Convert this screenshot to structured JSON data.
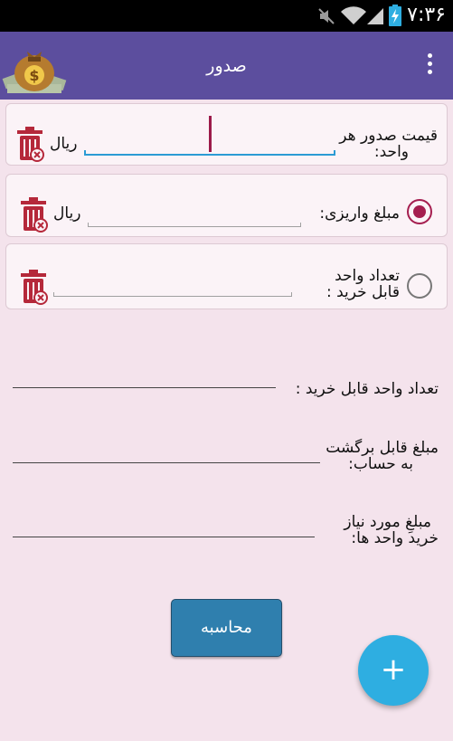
{
  "status_bar": {
    "time": "۷:۳۶",
    "icons": [
      "mute-icon",
      "wifi-icon",
      "signal-icon",
      "battery-charging-icon"
    ]
  },
  "app_bar": {
    "title": "صدور",
    "logo": "money-bag-icon",
    "menu": "overflow-menu-icon"
  },
  "fields": {
    "unit_price": {
      "label_line1": "قیمت صدور هر",
      "label_line2": "واحد:",
      "unit": "ریال",
      "value": ""
    },
    "deposit_amount": {
      "label": "مبلغ واریزی:",
      "unit": "ریال",
      "value": "",
      "selected": true
    },
    "unit_count": {
      "label_line1": "تعداد واحد",
      "label_line2": "قابل خرید :",
      "value": "",
      "selected": false
    }
  },
  "results": {
    "purchasable_units": {
      "label": "تعداد واحد قابل خرید :",
      "value": ""
    },
    "refund_amount": {
      "label_line1": "مبلغ قابل برگشت",
      "label_line2": "به حساب:",
      "value": ""
    },
    "required_amount": {
      "label_line1": "مبلغِ مورد نیاز",
      "label_line2": "خرید واحد ها:",
      "value": ""
    }
  },
  "calculate_button": "محاسبه",
  "fab": "+",
  "colors": {
    "app_bar": "#5c4e9e",
    "background": "#f4e3ec",
    "accent": "#a51e4f",
    "button": "#2f7fae",
    "fab": "#2eaee1",
    "focus_line": "#2b9bd4"
  }
}
